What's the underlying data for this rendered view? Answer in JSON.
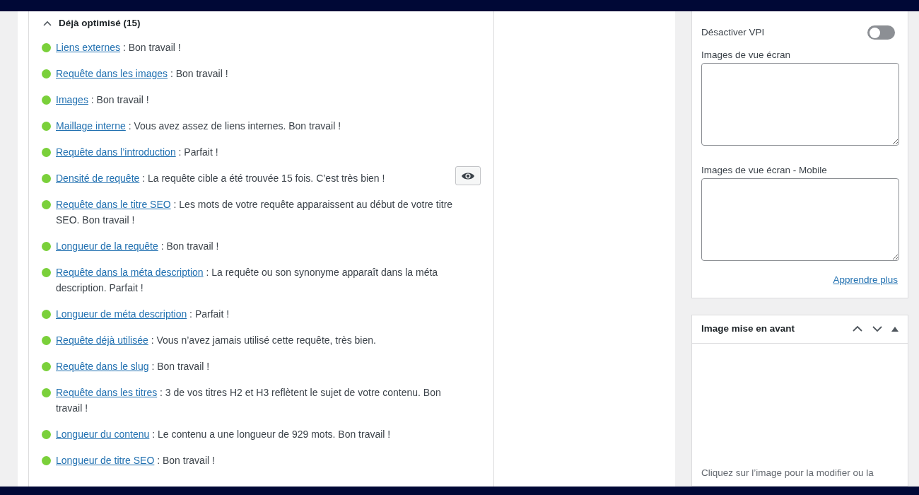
{
  "analysis": {
    "heading": "Déjà optimisé (15)",
    "expanded": true,
    "items": [
      {
        "link": "Liens externes",
        "text": " : Bon travail !",
        "color": "#7ad03a"
      },
      {
        "link": "Requête dans les images",
        "text": " : Bon travail !",
        "color": "#7ad03a"
      },
      {
        "link": "Images",
        "text": " : Bon travail !",
        "color": "#7ad03a"
      },
      {
        "link": "Maillage interne",
        "text": " : Vous avez assez de liens internes. Bon travail !",
        "color": "#7ad03a"
      },
      {
        "link": "Requête dans l’introduction",
        "text": " : Parfait !",
        "color": "#7ad03a"
      },
      {
        "link": "Densité de requête",
        "text": " : La requête cible a été trouvée 15 fois. C’est très bien !",
        "color": "#7ad03a",
        "eye_button": true
      },
      {
        "link": "Requête dans le titre SEO",
        "text": " : Les mots de votre requête apparaissent au début de votre titre SEO. Bon travail !",
        "color": "#7ad03a"
      },
      {
        "link": "Longueur de la requête",
        "text": " : Bon travail !",
        "color": "#7ad03a"
      },
      {
        "link": "Requête dans la méta description",
        "text": " : La requête ou son synonyme apparaît dans la méta description. Parfait !",
        "color": "#7ad03a"
      },
      {
        "link": "Longueur de méta description",
        "text": " : Parfait !",
        "color": "#7ad03a"
      },
      {
        "link": "Requête déjà utilisée",
        "text": " : Vous n’avez jamais utilisé cette requête, très bien.",
        "color": "#7ad03a"
      },
      {
        "link": "Requête dans le slug",
        "text": " : Bon travail !",
        "color": "#7ad03a"
      },
      {
        "link": "Requête dans les titres",
        "text": " : 3 de vos titres H2 et H3 reflètent le sujet de votre contenu. Bon travail !",
        "color": "#7ad03a"
      },
      {
        "link": "Longueur du contenu",
        "text": " : Le contenu a une longueur de 929 mots. Bon travail !",
        "color": "#7ad03a"
      },
      {
        "link": "Longueur de titre SEO",
        "text": " : Bon travail !",
        "color": "#7ad03a"
      }
    ]
  },
  "sidebar": {
    "toggle": {
      "label": "Désactiver VPI",
      "on": false
    },
    "fields": [
      {
        "label": "Images de vue écran"
      },
      {
        "label": "Images de vue écran - Mobile"
      }
    ],
    "link": "Apprendre plus",
    "featured_image": {
      "title": "Image mise en avant",
      "hint": "Cliquez sur l’image pour la modifier ou la"
    }
  }
}
